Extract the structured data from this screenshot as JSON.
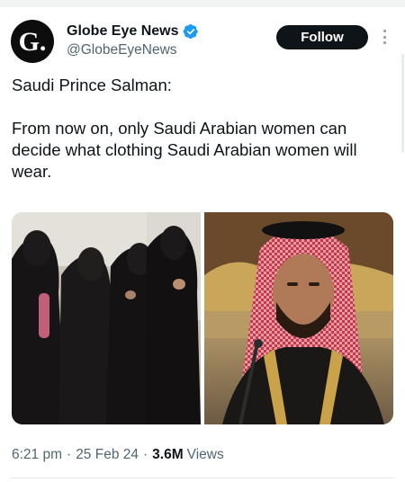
{
  "author": {
    "display_name": "Globe Eye News",
    "handle": "@GlobeEyeNews",
    "avatar_letter": "G.",
    "verified": true,
    "verified_color": "#1d9bf0"
  },
  "actions": {
    "follow_label": "Follow"
  },
  "tweet": {
    "line1": "Saudi Prince Salman:",
    "line2": "From now on, only Saudi Arabian women can decide what clothing Saudi Arabian women will wear."
  },
  "media": [
    {
      "name": "photo-women-in-abayas"
    },
    {
      "name": "photo-prince-salman"
    }
  ],
  "meta": {
    "time": "6:21 pm",
    "date": "25 Feb 24",
    "views_count": "3.6M",
    "views_label": "Views"
  },
  "colors": {
    "text": "#0f1419",
    "muted": "#536471",
    "follow_bg": "#0f1419"
  }
}
